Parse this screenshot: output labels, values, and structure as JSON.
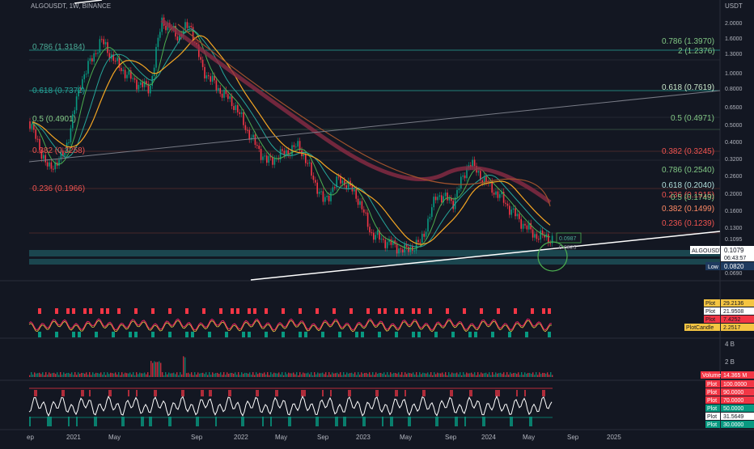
{
  "symbol_line": "ALGOUSDT, 1W, BINANCE",
  "currency": "USDT",
  "price_scale": [
    "2.0000",
    "1.6000",
    "1.3000",
    "1.0000",
    "0.8000",
    "0.6500",
    "0.5000",
    "0.4000",
    "0.3200",
    "0.2600",
    "0.2000",
    "0.1600",
    "0.1300",
    "0.1095",
    "0.0690"
  ],
  "fib_left": [
    {
      "text": "0.786 (1.3184)",
      "color": "#4caf99"
    },
    {
      "text": "0.618 (0.7372)",
      "color": "#26a69a"
    },
    {
      "text": "0.5 (0.4901)",
      "color": "#81c784"
    },
    {
      "text": "0.382 (0.3258)",
      "color": "#ef5350"
    },
    {
      "text": "0.236 (0.1966)",
      "color": "#ef5350"
    }
  ],
  "fib_right": [
    {
      "text": "0.786 (1.3970)",
      "color": "#81c784"
    },
    {
      "text": "2 (1.2376)",
      "color": "#81c784"
    },
    {
      "text": "0.618 (0.7619)",
      "color": "#c8e6c9"
    },
    {
      "text": "0.5 (0.4971)",
      "color": "#81c784"
    },
    {
      "text": "0.382 (0.3245)",
      "color": "#ef5350"
    },
    {
      "text": "0.786 (0.2540)",
      "color": "#81c784"
    },
    {
      "text": "0.618 (0.2040)",
      "color": "#b2dfdb"
    },
    {
      "text": "0.236 (0.1915)",
      "color": "#ef5350"
    },
    {
      "text": "0.5 (0.1749)",
      "color": "#81c784"
    },
    {
      "text": "0.382 (0.1499)",
      "color": "#ff8a65"
    },
    {
      "text": "0.236 (0.1239)",
      "color": "#ef5350"
    }
  ],
  "annotations": [
    "0.0987",
    "0.0825"
  ],
  "price_tag": {
    "name": "ALGOUSDT",
    "price": "0.1079",
    "countdown": "06:43:57"
  },
  "low_tag": {
    "label": "Low",
    "value": "0.0820"
  },
  "ind1_tags": [
    {
      "label": "Plot",
      "value": "29.2136",
      "color": "#f5c542"
    },
    {
      "label": "Plot",
      "value": "21.9508",
      "color": "#ffffff"
    },
    {
      "label": "Plot",
      "value": "7.4252",
      "color": "#f23645"
    },
    {
      "label": "PlotCandle",
      "value": "2.2517",
      "color": "#f5c542"
    }
  ],
  "vol_scale": [
    "4 B",
    "2 B"
  ],
  "vol_tag": {
    "label": "Volume",
    "value": "14.365 M",
    "color": "#f23645"
  },
  "rsi_tags": [
    {
      "label": "Plot",
      "value": "100.0000",
      "color": "#f23645"
    },
    {
      "label": "Plot",
      "value": "90.0000",
      "color": "#f23645"
    },
    {
      "label": "Plot",
      "value": "70.0000",
      "color": "#f23645"
    },
    {
      "label": "Plot",
      "value": "50.0000",
      "color": "#089981"
    },
    {
      "label": "Plot",
      "value": "31.5649",
      "color": "#ffffff"
    },
    {
      "label": "Plot",
      "value": "30.0000",
      "color": "#089981"
    }
  ],
  "time_axis": [
    "ep",
    "2021",
    "May",
    "Sep",
    "2022",
    "May",
    "Sep",
    "2023",
    "May",
    "Sep",
    "2024",
    "May",
    "Sep",
    "2025",
    "May"
  ]
}
